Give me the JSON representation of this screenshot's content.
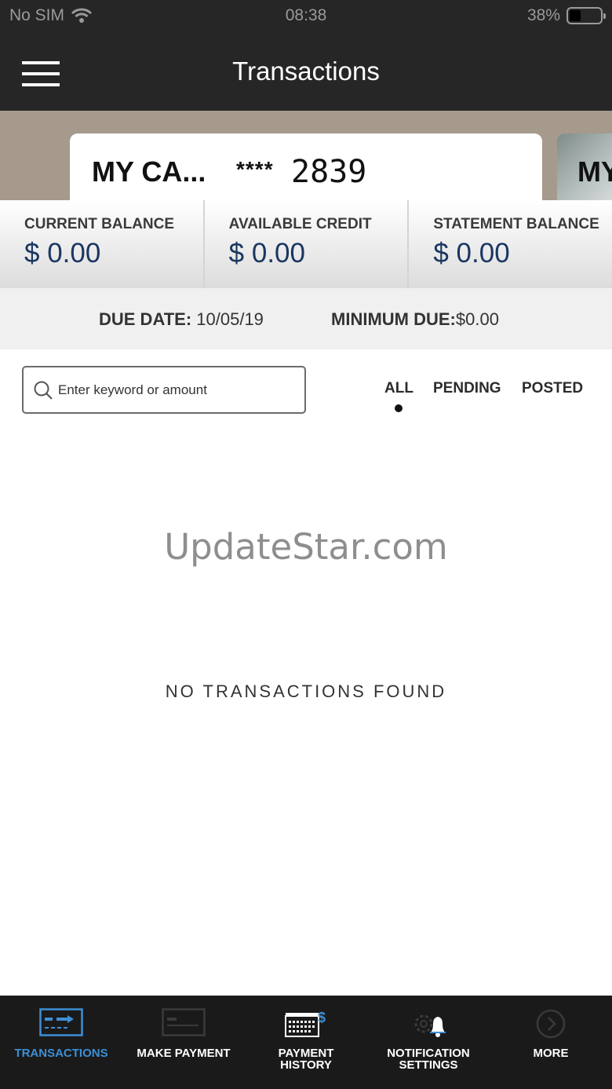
{
  "status_bar": {
    "carrier": "No SIM",
    "time": "08:38",
    "battery": "38%",
    "battery_level": 0.38
  },
  "header": {
    "title": "Transactions"
  },
  "cards": [
    {
      "name": "MY CA...",
      "mask": "****",
      "last4": "2839"
    },
    {
      "name": "MY"
    }
  ],
  "balances": [
    {
      "label": "CURRENT BALANCE",
      "value": "$ 0.00"
    },
    {
      "label": "AVAILABLE CREDIT",
      "value": "$ 0.00"
    },
    {
      "label": "STATEMENT BALANCE",
      "value": "$ 0.00"
    }
  ],
  "due": {
    "date_label": "DUE DATE:",
    "date_value": "10/05/19",
    "min_label": "MINIMUM DUE:",
    "min_value": "$0.00"
  },
  "search": {
    "placeholder": "Enter keyword or amount",
    "value": ""
  },
  "filters": {
    "all": "ALL",
    "pending": "PENDING",
    "posted": "POSTED",
    "selected": "ALL"
  },
  "watermark": "UpdateStar.com",
  "empty_message": "NO TRANSACTIONS FOUND",
  "tabs": [
    {
      "label": "TRANSACTIONS",
      "icon": "transactions-icon",
      "active": true
    },
    {
      "label": "MAKE PAYMENT",
      "icon": "card-payment-icon"
    },
    {
      "label": "PAYMENT HISTORY",
      "line1": "PAYMENT",
      "line2": "HISTORY",
      "icon": "payment-history-icon"
    },
    {
      "label": "NOTIFICATION SETTINGS",
      "line1": "NOTIFICATION",
      "line2": "SETTINGS",
      "icon": "bell-gear-icon"
    },
    {
      "label": "MORE",
      "icon": "chevron-circle-icon"
    }
  ],
  "colors": {
    "header_bg": "#262626",
    "accent": "#3d8fd6",
    "balance_value": "#1b3761",
    "tabbar_bg": "#1a1a1a"
  }
}
